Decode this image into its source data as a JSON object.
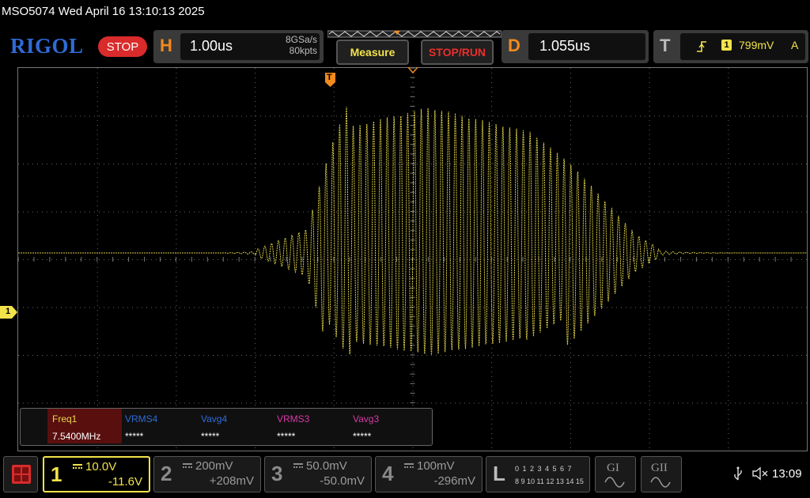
{
  "header": {
    "title_line": "MSO5074  Wed April 16 13:10:13 2025",
    "logo": "RIGOL",
    "run_state": "STOP",
    "horizontal": {
      "letter": "H",
      "timebase": "1.00us",
      "sample_rate": "8GSa/s",
      "memory": "80kpts"
    },
    "measure_label": "Measure",
    "stop_run_label": "STOP/RUN",
    "delay": {
      "letter": "D",
      "value": "1.055us"
    },
    "trigger": {
      "letter": "T",
      "source": "1",
      "level": "799mV",
      "mode": "A"
    }
  },
  "screen": {
    "trigger_marker": "T",
    "ch1_marker": "1"
  },
  "measurements": [
    {
      "name": "Freq1",
      "value": "7.5400MHz",
      "color": "#e8d84a"
    },
    {
      "name": "VRMS4",
      "value": "*****",
      "color": "#2f6bd6"
    },
    {
      "name": "Vavg4",
      "value": "*****",
      "color": "#2f6bd6"
    },
    {
      "name": "VRMS3",
      "value": "*****",
      "color": "#d63aa6"
    },
    {
      "name": "Vavg3",
      "value": "*****",
      "color": "#d63aa6"
    }
  ],
  "channels": [
    {
      "num": "1",
      "scale": "10.0V",
      "offset": "-11.6V",
      "color": "#f2e34a",
      "active": true
    },
    {
      "num": "2",
      "scale": "200mV",
      "offset": "+208mV",
      "color": "#8a8a8a"
    },
    {
      "num": "3",
      "scale": "50.0mV",
      "offset": "-50.0mV",
      "color": "#8a8a8a"
    },
    {
      "num": "4",
      "scale": "100mV",
      "offset": "-296mV",
      "color": "#8a8a8a"
    }
  ],
  "logic": {
    "letter": "L",
    "row1": "0 1 2 3  4 5 6 7",
    "row2": "8 9 10 11 12 13 14 15"
  },
  "generators": [
    "GI",
    "GII"
  ],
  "status": {
    "usb_icon": "usb-icon",
    "mute_icon": "speaker-mute-icon",
    "time": "13:09"
  },
  "colors": {
    "ch1": "#f2e34a",
    "accent_orange": "#f28a1d",
    "accent_red": "#e8302c",
    "grid": "#777777"
  }
}
